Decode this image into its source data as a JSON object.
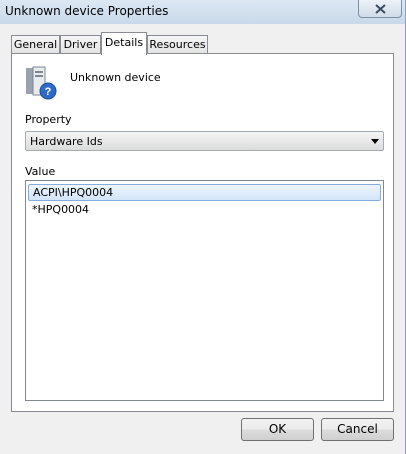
{
  "window": {
    "title": "Unknown device Properties"
  },
  "tabs": [
    {
      "label": "General"
    },
    {
      "label": "Driver"
    },
    {
      "label": "Details",
      "active": true
    },
    {
      "label": "Resources"
    }
  ],
  "device": {
    "name": "Unknown device"
  },
  "property": {
    "label": "Property",
    "selected": "Hardware Ids"
  },
  "value": {
    "label": "Value",
    "items": [
      "ACPI\\HPQ0004",
      "*HPQ0004"
    ]
  },
  "buttons": {
    "ok": "OK",
    "cancel": "Cancel"
  },
  "colors": {
    "selection_border": "#84acdd",
    "selection_fill": "#d3e5fa"
  }
}
